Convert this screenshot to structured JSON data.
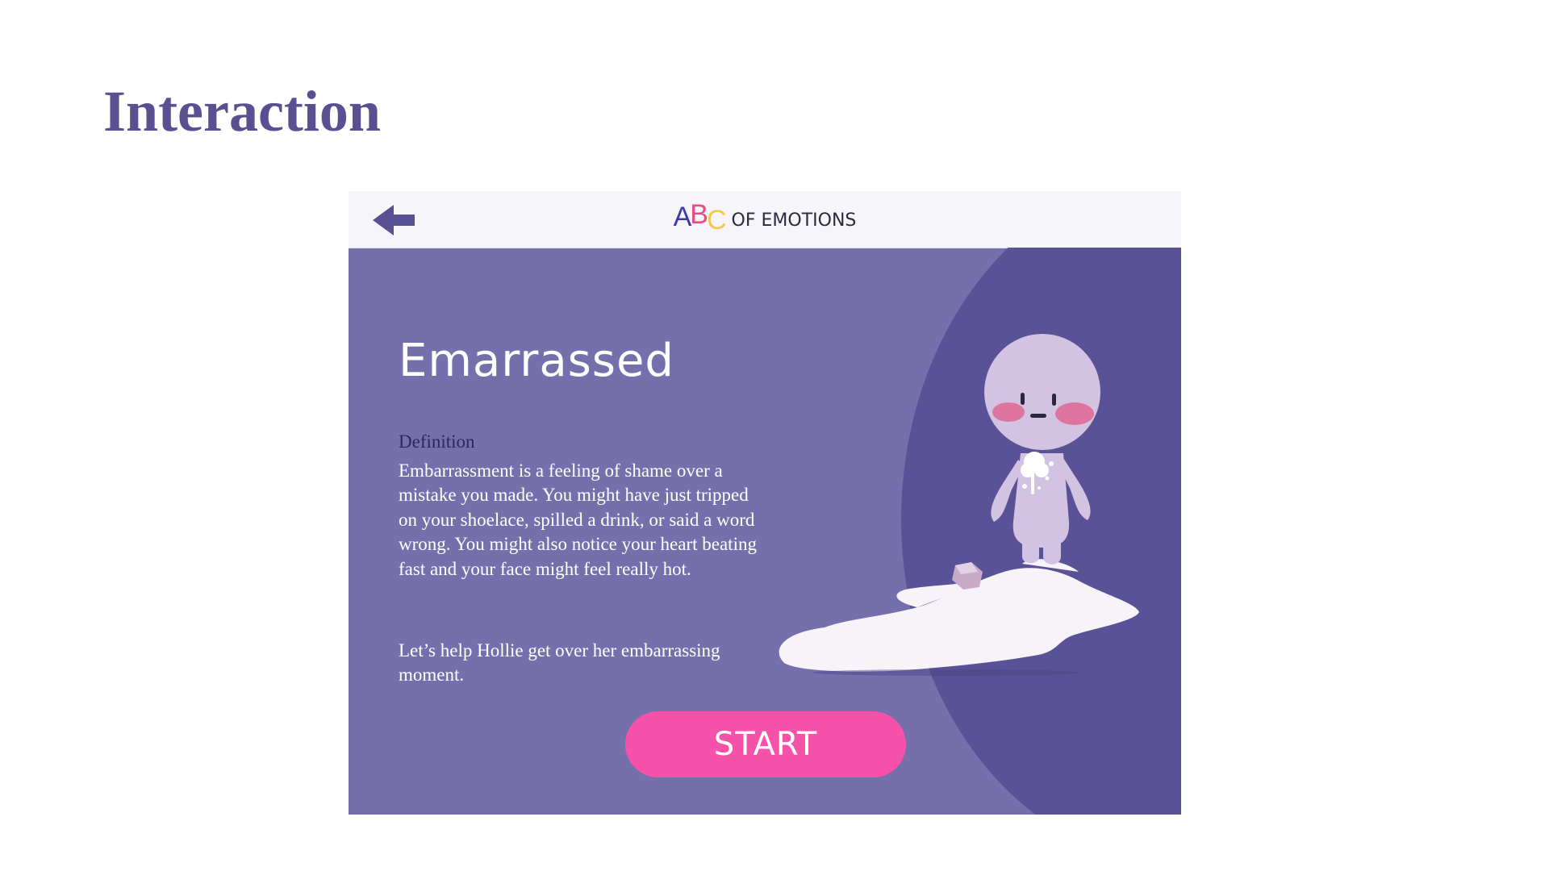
{
  "slide": {
    "title": "Interaction"
  },
  "app": {
    "header": {
      "back_icon": "back-arrow-icon",
      "logo_letters": [
        "A",
        "B",
        "C"
      ],
      "logo_text": "OF EMOTIONS"
    },
    "emotion": {
      "title": "Emarrassed",
      "definition_heading": "Definition",
      "definition_text": "Embarrassment is a feeling of shame over a mistake you made. You might have just tripped on your shoelace, spilled a drink, or said a word wrong. You might also notice your heart beating fast and your face might feel really hot.",
      "prompt_text": "Let’s help Hollie get over her embarrassing moment."
    },
    "start_button_label": "START"
  },
  "colors": {
    "slide_title": "#595091",
    "panel_background": "#7570ac",
    "circle_background": "#5a5296",
    "start_button": "#f652aa",
    "definition_heading": "#2e2562",
    "character": "#d3c3e3",
    "cheeks": "#e8346a",
    "spill": "#f8f3f8"
  }
}
